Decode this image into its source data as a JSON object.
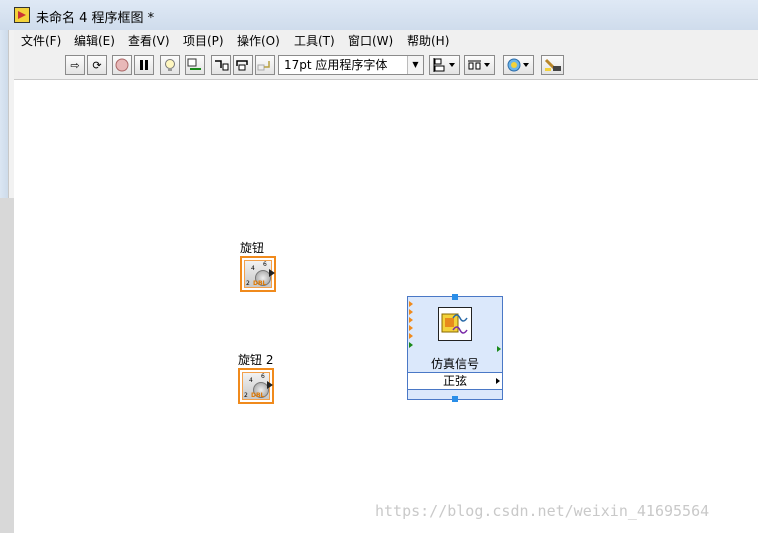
{
  "window": {
    "title": "未命名 4 程序框图 *"
  },
  "menu": [
    "文件(F)",
    "编辑(E)",
    "查看(V)",
    "项目(P)",
    "操作(O)",
    "工具(T)",
    "窗口(W)",
    "帮助(H)"
  ],
  "toolbar": {
    "font": "17pt 应用程序字体",
    "icons": [
      "run-arrow-icon",
      "run-continuously-icon",
      "abort-icon",
      "pause-icon",
      "highlight-execution-icon",
      "retain-wire-values-icon",
      "step-into-icon",
      "step-over-icon",
      "step-out-icon",
      "align-objects-icon",
      "distribute-objects-icon",
      "reorder-icon",
      "clean-up-diagram-icon"
    ]
  },
  "diagram": {
    "knobs": [
      {
        "label": "旋钮",
        "type": "DBL",
        "scale": [
          "2",
          "4",
          "6"
        ]
      },
      {
        "label": "旋钮 2",
        "type": "DBL",
        "scale": [
          "2",
          "4",
          "6"
        ]
      }
    ],
    "express_vi": {
      "name": "仿真信号",
      "mode": "正弦"
    }
  },
  "colors": {
    "accent_orange": "#f08a1c",
    "express_border": "#4a78c6",
    "express_fill": "#dbe8fb"
  },
  "watermark": "https://blog.csdn.net/weixin_41695564"
}
